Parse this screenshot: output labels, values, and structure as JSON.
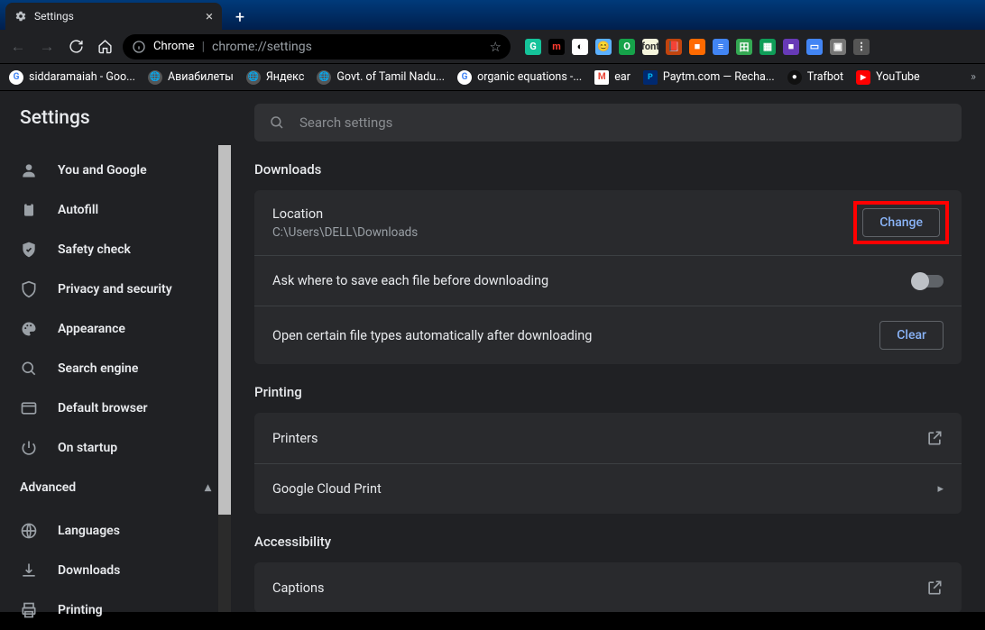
{
  "browser": {
    "tab_title": "Settings",
    "url_host_label": "Chrome",
    "url": "chrome://settings",
    "extensions": [
      {
        "name": "grammarly",
        "bg": "#15c39a",
        "txt": "G"
      },
      {
        "name": "m-ext",
        "bg": "#000",
        "txt": "m",
        "color": "#ff3b30"
      },
      {
        "name": "contrast",
        "bg": "#fff",
        "txt": "◐",
        "color": "#000"
      },
      {
        "name": "emoji-ext",
        "bg": "#5bb0ff",
        "txt": "😊"
      },
      {
        "name": "ublock",
        "bg": "#16a34a",
        "txt": "O"
      },
      {
        "name": "font-ext",
        "bg": "#f5f5dc",
        "txt": "font",
        "color": "#333"
      },
      {
        "name": "reader-ext",
        "bg": "#c1440e",
        "txt": "📕"
      },
      {
        "name": "orange-ext",
        "bg": "#ff6a00",
        "txt": "■"
      },
      {
        "name": "docs-ext",
        "bg": "#4285f4",
        "txt": "≡"
      },
      {
        "name": "sheets-badge",
        "bg": "#34a853",
        "txt": "田"
      },
      {
        "name": "sheets2",
        "bg": "#0f9d58",
        "txt": "▦"
      },
      {
        "name": "forms-ext",
        "bg": "#673ab7",
        "txt": "■"
      },
      {
        "name": "slides-ext",
        "bg": "#4285f4",
        "txt": "▭"
      },
      {
        "name": "gray-ext",
        "bg": "#757575",
        "txt": "▣"
      },
      {
        "name": "last-ext",
        "bg": "#555",
        "txt": "⋮"
      }
    ],
    "bookmarks": [
      {
        "label": "siddaramaiah - Goo...",
        "fav": "G",
        "cls": ""
      },
      {
        "label": "Авиабилеты",
        "fav": "🌐",
        "cls": "globe"
      },
      {
        "label": "Яндекс",
        "fav": "🌐",
        "cls": "globe"
      },
      {
        "label": "Govt. of Tamil Nadu...",
        "fav": "🌐",
        "cls": "globe"
      },
      {
        "label": "organic equations -...",
        "fav": "G",
        "cls": ""
      },
      {
        "label": "ear",
        "fav": "M",
        "cls": "gmail"
      },
      {
        "label": "Paytm.com — Recha...",
        "fav": "P",
        "cls": "paytm"
      },
      {
        "label": "Trafbot",
        "fav": "●",
        "cls": "traf"
      },
      {
        "label": "YouTube",
        "fav": "▶",
        "cls": "yt"
      }
    ]
  },
  "settings": {
    "title": "Settings",
    "search_placeholder": "Search settings",
    "sidebar": [
      {
        "icon": "person",
        "label": "You and Google"
      },
      {
        "icon": "clipboard",
        "label": "Autofill"
      },
      {
        "icon": "shield-check",
        "label": "Safety check"
      },
      {
        "icon": "shield",
        "label": "Privacy and security"
      },
      {
        "icon": "palette",
        "label": "Appearance"
      },
      {
        "icon": "search",
        "label": "Search engine"
      },
      {
        "icon": "browser",
        "label": "Default browser"
      },
      {
        "icon": "power",
        "label": "On startup"
      }
    ],
    "advanced_label": "Advanced",
    "advanced_items": [
      {
        "icon": "globe",
        "label": "Languages"
      },
      {
        "icon": "download",
        "label": "Downloads"
      },
      {
        "icon": "print",
        "label": "Printing"
      }
    ],
    "sections": {
      "downloads": {
        "title": "Downloads",
        "location_label": "Location",
        "location_path": "C:\\Users\\DELL\\Downloads",
        "change_btn": "Change",
        "ask_label": "Ask where to save each file before downloading",
        "open_types_label": "Open certain file types automatically after downloading",
        "clear_btn": "Clear"
      },
      "printing": {
        "title": "Printing",
        "printers_label": "Printers",
        "cloud_label": "Google Cloud Print"
      },
      "accessibility": {
        "title": "Accessibility",
        "captions_label": "Captions"
      }
    }
  }
}
